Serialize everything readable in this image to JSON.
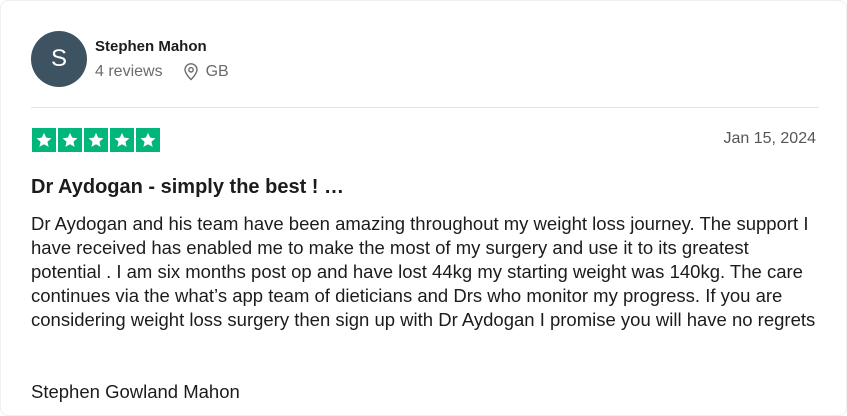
{
  "reviewer": {
    "initial": "S",
    "name": "Stephen Mahon",
    "reviews": "4 reviews",
    "country": "GB",
    "location_icon": "location-pin-icon",
    "avatar_color": "#3d5361"
  },
  "review": {
    "rating": 5,
    "rating_max": 5,
    "star_color": "#00b67a",
    "date": "Jan 15, 2024",
    "title": "Dr Aydogan - simply the best ! …",
    "body": "Dr Aydogan and his team have been amazing throughout my weight loss journey. The support I have received has enabled me to make the most of my surgery and use it to its greatest potential . I am six months post op and have lost 44kg my starting weight was 140kg. The care continues via the what’s app team of dieticians and Drs who monitor my progress. If you are considering weight loss surgery then sign up with Dr Aydogan I promise you will have no regrets",
    "signoff": "Stephen Gowland Mahon"
  }
}
